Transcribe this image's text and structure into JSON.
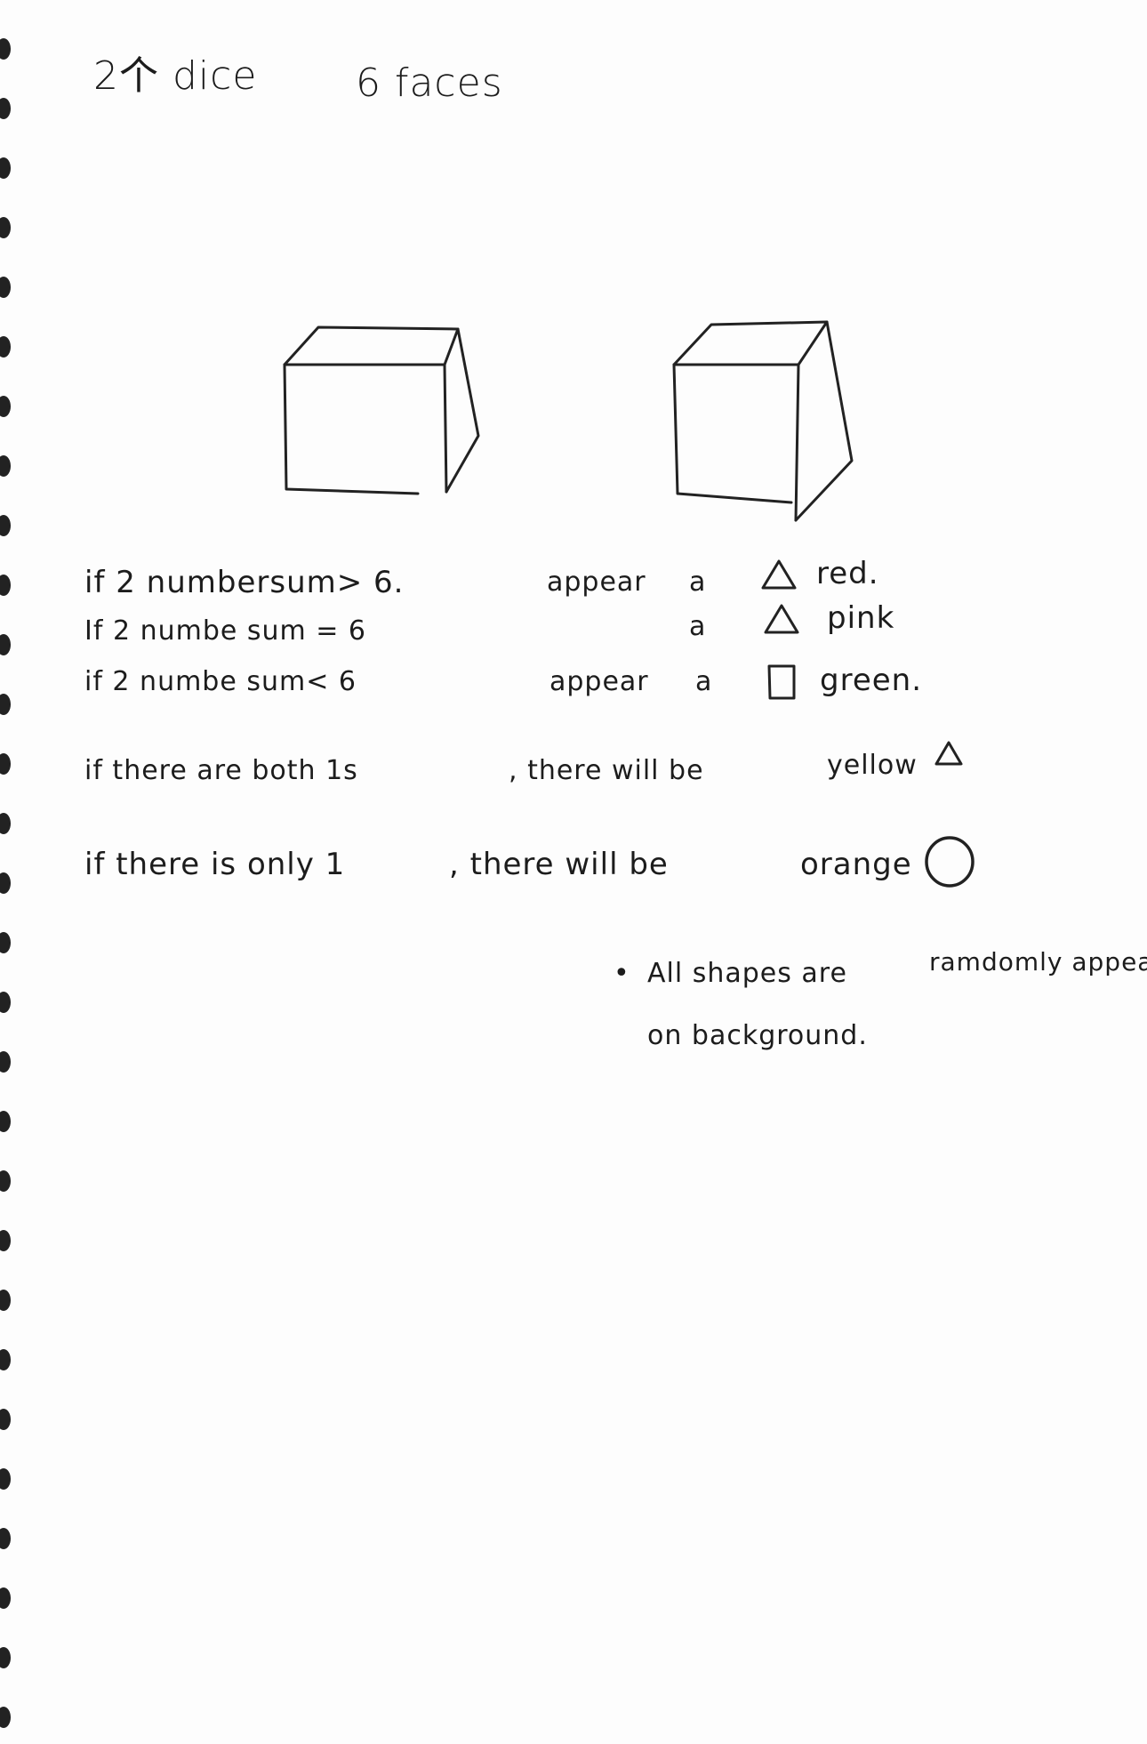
{
  "header": {
    "dice_count": "2个 dice",
    "faces": "6 faces"
  },
  "rules": [
    {
      "condition": "if 2 numbersum> 6.",
      "verb": "appear",
      "article": "a",
      "shape_icon": "triangle-icon",
      "color_word": "red."
    },
    {
      "condition": "If 2 numbe sum = 6",
      "verb": "",
      "article": "a",
      "shape_icon": "triangle-icon",
      "color_word": "pink"
    },
    {
      "condition": "if 2 numbe sum< 6",
      "verb": "appear",
      "article": "a",
      "shape_icon": "square-icon",
      "color_word": "green."
    }
  ],
  "special_rules": {
    "both_ones": {
      "part1": "if there are both 1s",
      "part2": ", there will be",
      "part3": "yellow",
      "shape_icon": "triangle-icon"
    },
    "only_one": {
      "part1": "if there is only 1",
      "part2": ", there will be",
      "part3": "orange",
      "shape_icon": "circle-icon"
    }
  },
  "note": {
    "bullet": "•",
    "line1_a": "All shapes are",
    "line1_b": "ramdomly appear",
    "line2": "on background."
  },
  "icons": [
    "cube-icon",
    "triangle-icon",
    "square-icon",
    "circle-icon",
    "spiral-binding-icon"
  ]
}
